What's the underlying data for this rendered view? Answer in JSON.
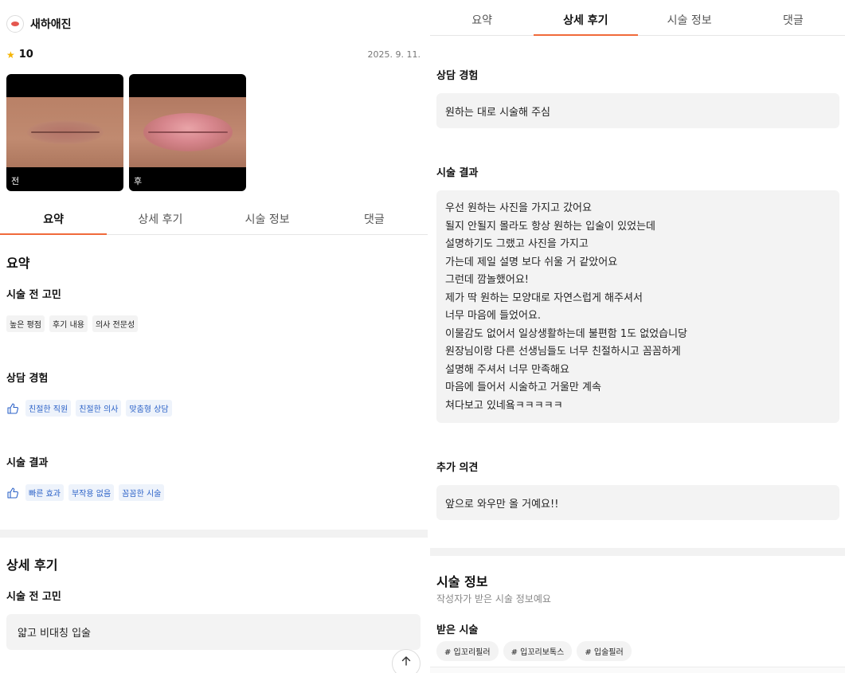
{
  "header": {
    "clinic_name": "새하애진",
    "rating": "10",
    "date": "2025. 9. 11."
  },
  "photos": {
    "before_label": "전",
    "after_label": "후"
  },
  "tabs": [
    {
      "label": "요약"
    },
    {
      "label": "상세 후기"
    },
    {
      "label": "시술 정보"
    },
    {
      "label": "댓글"
    }
  ],
  "summary": {
    "title": "요약",
    "worries": {
      "title": "시술 전 고민",
      "chips": [
        "높은 평점",
        "후기 내용",
        "의사 전문성"
      ]
    },
    "consult": {
      "title": "상담 경험",
      "chips": [
        "친절한 직원",
        "친절한 의사",
        "맞춤형 상담"
      ]
    },
    "result": {
      "title": "시술 결과",
      "chips": [
        "빠른 효과",
        "부작용 없음",
        "꼼꼼한 시술"
      ]
    }
  },
  "detail": {
    "title": "상세 후기",
    "worries_title": "시술 전 고민",
    "worries_text": "얇고 비대칭 입술",
    "consult_title": "상담 경험",
    "consult_text": "원하는 대로 시술해 주심",
    "result_title": "시술 결과",
    "result_lines": [
      "우선 원하는 사진을 가지고 갔어요",
      "될지 안될지 몰라도 항상 원하는 입술이 있었는데",
      "설명하기도 그랬고 사진을 가지고",
      "가는데 제일 설명 보다 쉬울 거 같았어요",
      "그런데 깜놀했어요!",
      "제가 딱 원하는 모양대로 자연스럽게 해주셔서",
      "너무 마음에 들었어요.",
      "이물감도 없어서 일상생활하는데 불편함 1도 없었습니당",
      "원장님이랑 다른 선생님들도 너무 친절하시고 꼼꼼하게",
      "설명해 주셔서 너무 만족해요",
      "마음에 들어서 시술하고 거울만 계속",
      "쳐다보고 있네욬ㅋㅋㅋㅋㅋ"
    ],
    "extra_title": "추가 의견",
    "extra_text": "앞으로 와우만 올 거예요!!"
  },
  "treatment": {
    "title": "시술 정보",
    "subtitle": "작성자가 받은 시술 정보예요",
    "received_title": "받은 시술",
    "tags": [
      "# 입꼬리필러",
      "# 입꼬리보톡스",
      "# 입술필러"
    ]
  },
  "icons": {
    "star": "star-icon",
    "thumb": "thumbs-up-icon",
    "scroll_top": "arrow-up-icon",
    "logo": "clinic-logo-icon"
  },
  "colors": {
    "accent": "#f06a3a",
    "chip_blue_text": "#2d63c8",
    "chip_blue_bg": "#eef3fb",
    "star": "#f5b400"
  }
}
